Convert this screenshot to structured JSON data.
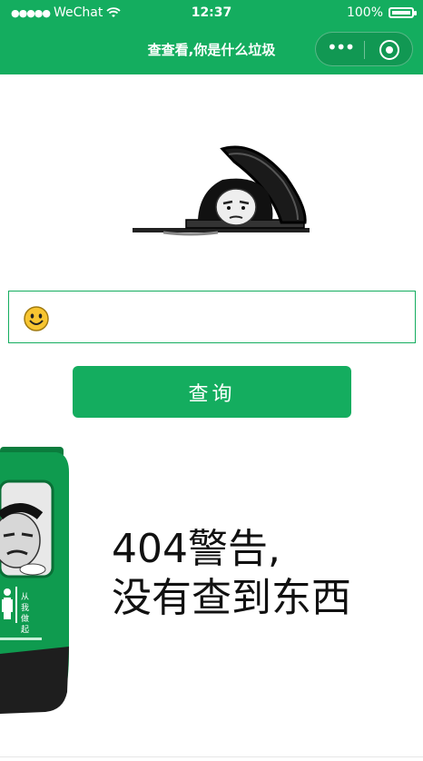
{
  "status_bar": {
    "signal": "●●●●●",
    "carrier": "WeChat",
    "time": "12:37",
    "battery": "100%"
  },
  "nav": {
    "title": "查查看,你是什么垃圾",
    "capsule_more": "•••"
  },
  "search": {
    "placeholder": "",
    "value": ""
  },
  "query_button": {
    "label": "查询"
  },
  "result": {
    "line1": "404警告,",
    "line2": "没有查到东西"
  },
  "colors": {
    "brand": "#14ad5f",
    "bin_green": "#0f9b4f",
    "text": "#111111"
  }
}
